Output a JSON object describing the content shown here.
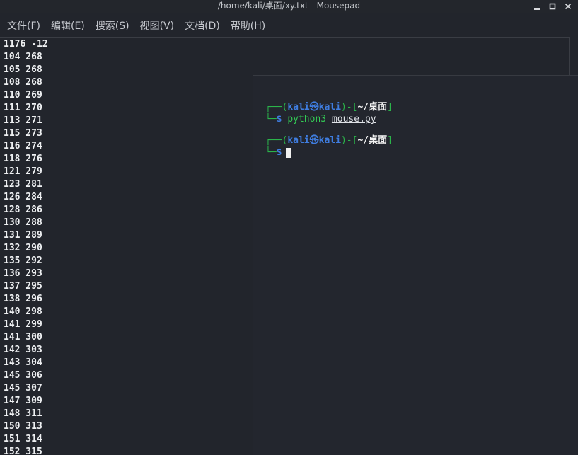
{
  "window": {
    "title": "/home/kali/桌面/xy.txt - Mousepad"
  },
  "menu": [
    {
      "label": "文件(F)"
    },
    {
      "label": "编辑(E)"
    },
    {
      "label": "搜索(S)"
    },
    {
      "label": "视图(V)"
    },
    {
      "label": "文档(D)"
    },
    {
      "label": "帮助(H)"
    }
  ],
  "editor": {
    "lines": [
      "1176 -12",
      "104 268",
      "105 268",
      "108 268",
      "110 269",
      "111 270",
      "113 271",
      "115 273",
      "116 274",
      "118 276",
      "121 279",
      "123 281",
      "126 284",
      "128 286",
      "130 288",
      "131 289",
      "132 290",
      "135 292",
      "136 293",
      "137 295",
      "138 296",
      "140 298",
      "141 299",
      "141 300",
      "142 303",
      "143 304",
      "145 306",
      "145 307",
      "147 309",
      "148 311",
      "150 313",
      "151 314",
      "152 315"
    ]
  },
  "terminal": {
    "prompt1": {
      "open": "┌──(",
      "user": "kali",
      "at_symbol": "㉿",
      "host": "kali",
      "mid": ")-[",
      "path": "~/桌面",
      "close": "]",
      "corner": "└─",
      "dollar": "$",
      "command": "python3",
      "argument": "mouse.py"
    },
    "prompt2": {
      "open": "┌──(",
      "user": "kali",
      "at_symbol": "㉿",
      "host": "kali",
      "mid": ")-[",
      "path": "~/桌面",
      "close": "]",
      "corner": "└─",
      "dollar": "$"
    }
  },
  "colors": {
    "background": "#22252c",
    "prompt_green": "#2bb34a",
    "prompt_blue": "#3f7de0"
  },
  "icons": [
    "minimize-icon",
    "maximize-icon",
    "close-icon"
  ]
}
